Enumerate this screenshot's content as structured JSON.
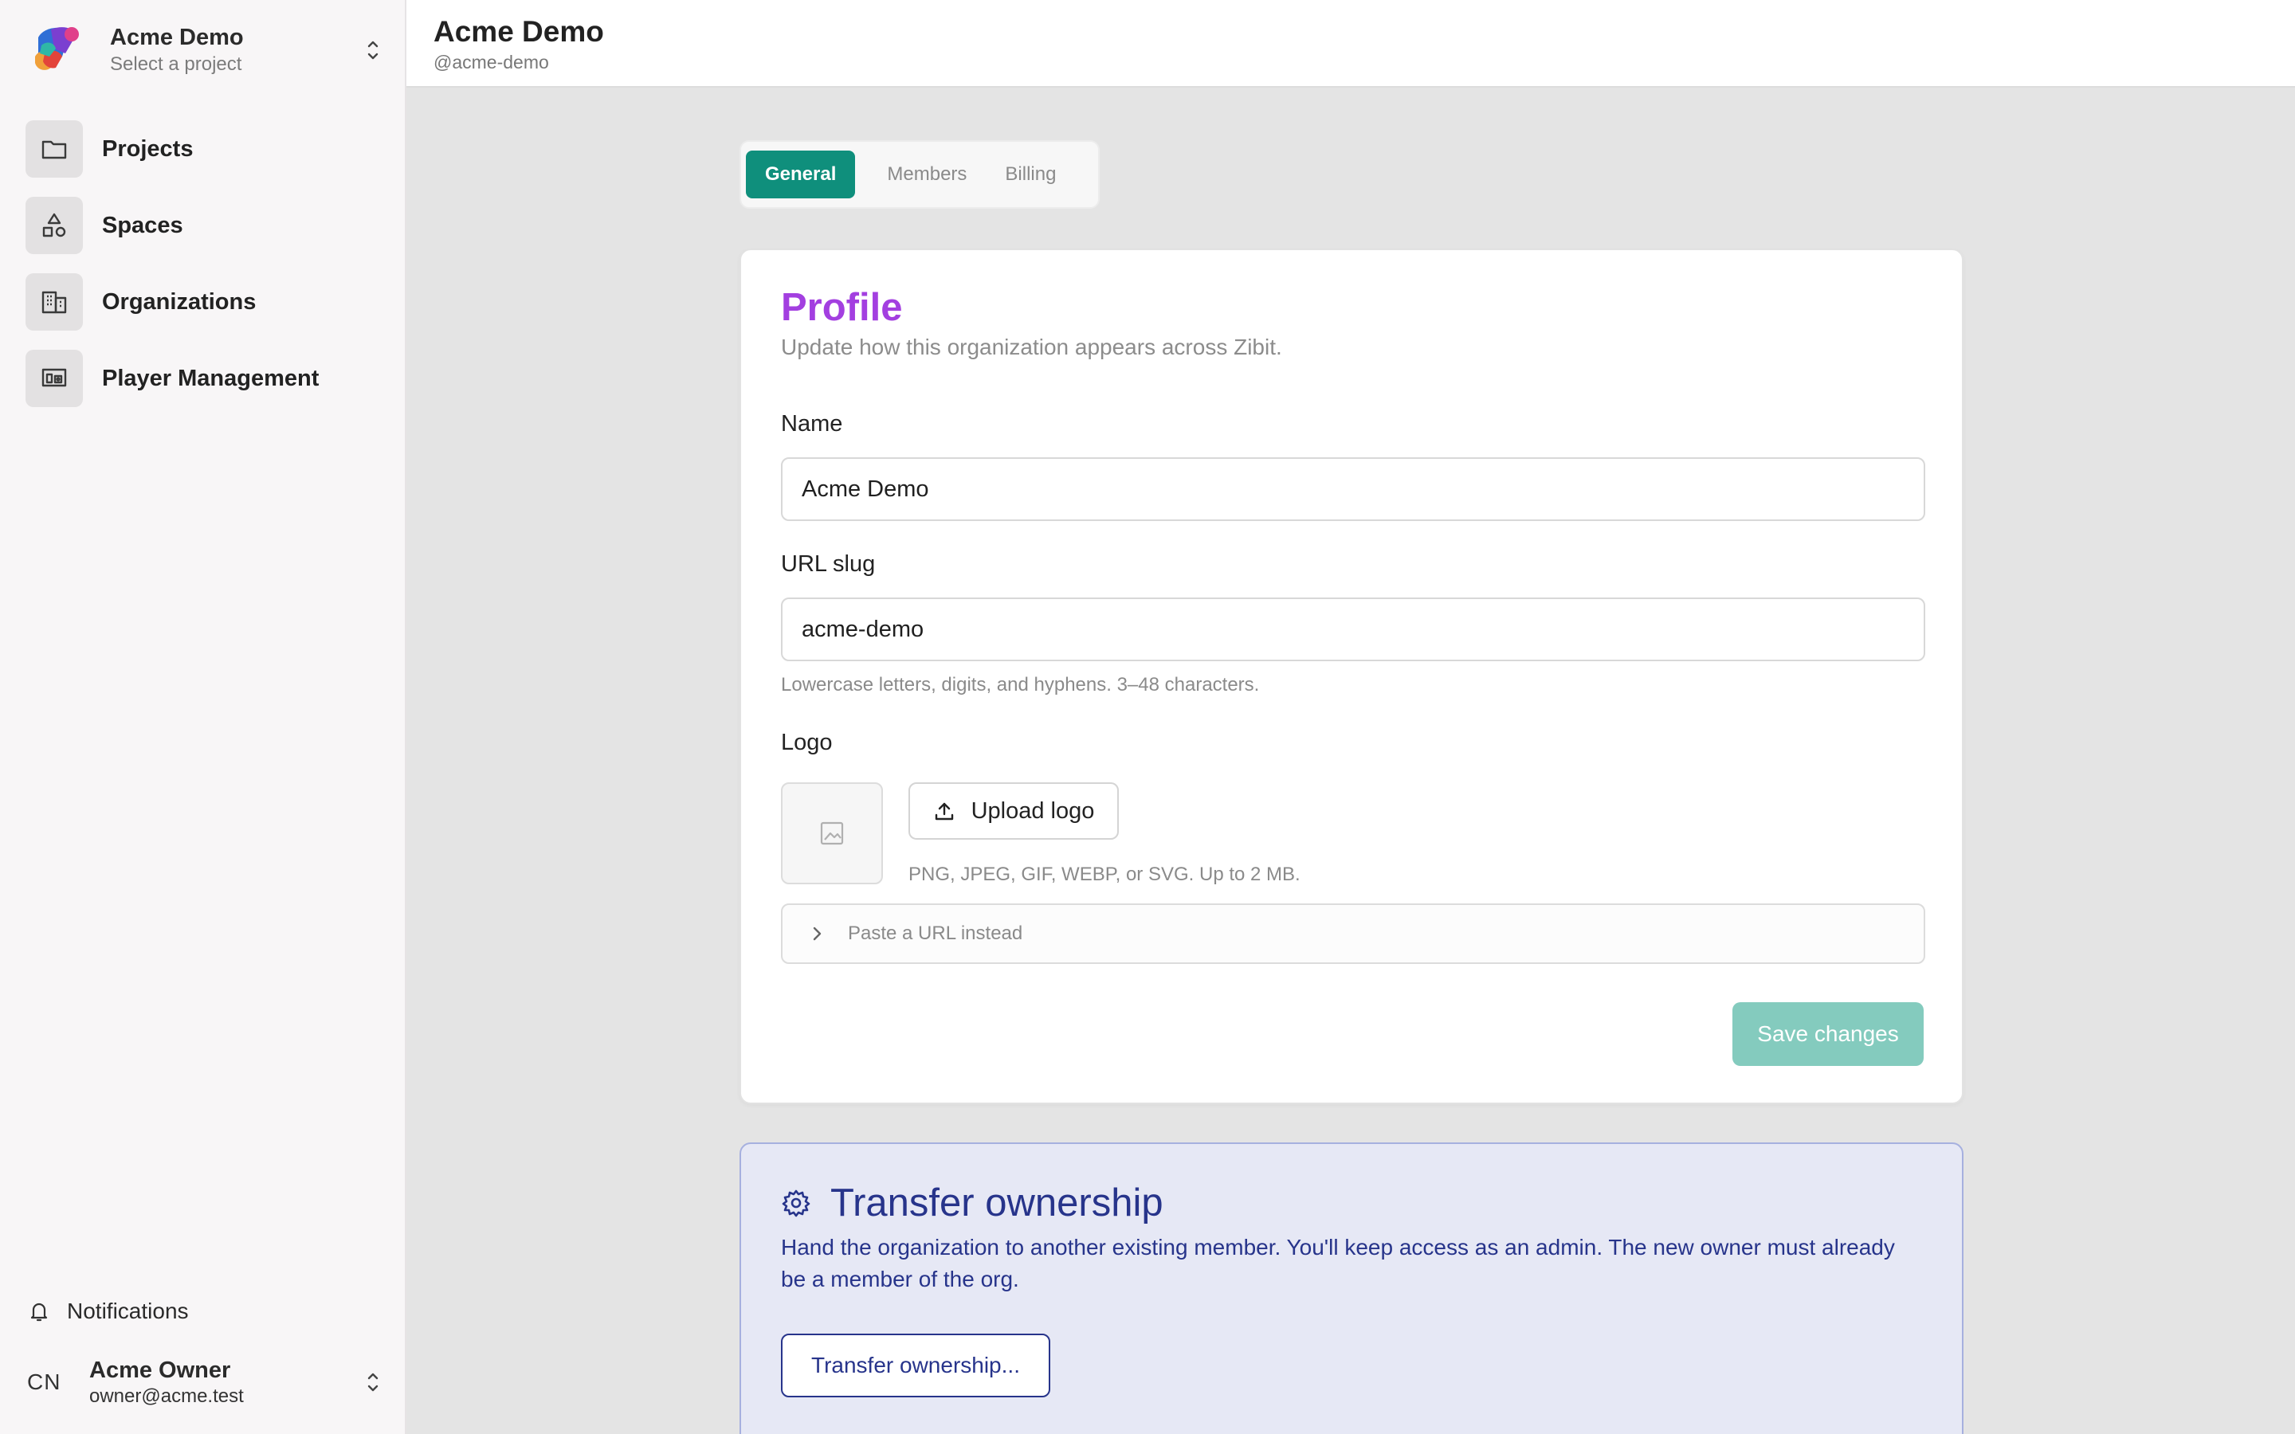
{
  "workspace": {
    "name": "Acme Demo",
    "subtitle": "Select a project"
  },
  "sidebar": {
    "items": [
      {
        "label": "Projects",
        "icon": "folder-icon"
      },
      {
        "label": "Spaces",
        "icon": "shapes-icon"
      },
      {
        "label": "Organizations",
        "icon": "building-icon"
      },
      {
        "label": "Player Management",
        "icon": "monitor-speaker-icon"
      }
    ],
    "notifications_label": "Notifications"
  },
  "user": {
    "initials": "CN",
    "name": "Acme Owner",
    "email": "owner@acme.test"
  },
  "header": {
    "title": "Acme Demo",
    "subtitle": "@acme-demo"
  },
  "tabs": [
    {
      "label": "General",
      "active": true
    },
    {
      "label": "Members",
      "active": false
    },
    {
      "label": "Billing",
      "active": false
    }
  ],
  "profile": {
    "title": "Profile",
    "subtitle": "Update how this organization appears across Zibit.",
    "name_label": "Name",
    "name_value": "Acme Demo",
    "slug_label": "URL slug",
    "slug_value": "acme-demo",
    "slug_hint": "Lowercase letters, digits, and hyphens. 3–48 characters.",
    "logo_label": "Logo",
    "upload_label": "Upload logo",
    "upload_hint": "PNG, JPEG, GIF, WEBP, or SVG. Up to 2 MB.",
    "paste_url_label": "Paste a URL instead",
    "save_label": "Save changes"
  },
  "transfer": {
    "title": "Transfer ownership",
    "description": "Hand the organization to another existing member. You'll keep access as an admin. The new owner must already be a member of the org.",
    "button_label": "Transfer ownership..."
  },
  "colors": {
    "accent_teal": "#0f8f7c",
    "save_disabled": "#84cbbe",
    "profile_title": "#a33fe0",
    "transfer_blue": "#27348b",
    "transfer_bg": "#e6e8f5"
  }
}
